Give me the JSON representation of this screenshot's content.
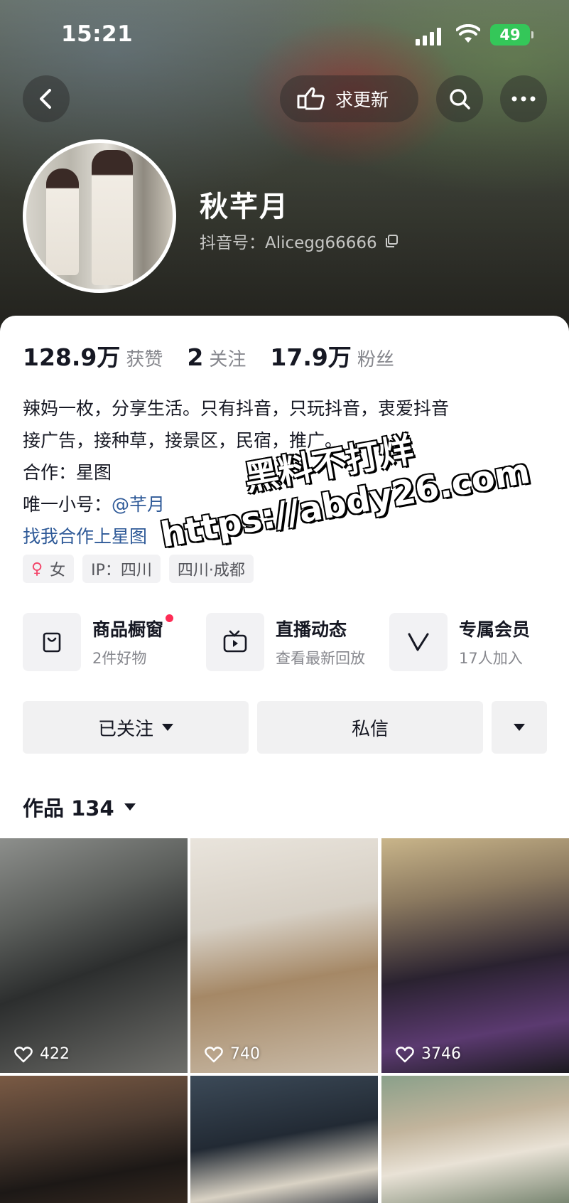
{
  "status_bar": {
    "time": "15:21",
    "battery": "49"
  },
  "header": {
    "request_update_label": "求更新",
    "icons": [
      "back-icon",
      "hand-point-icon",
      "search-icon",
      "more-icon"
    ]
  },
  "profile": {
    "nickname": "秋芊月",
    "douyin_id": "抖音号：Alicegg66666"
  },
  "stats": [
    {
      "value": "128.9万",
      "label": "获赞"
    },
    {
      "value": "2",
      "label": "关注"
    },
    {
      "value": "17.9万",
      "label": "粉丝"
    }
  ],
  "bio": {
    "line1": "辣妈一枚，分享生活。只有抖音，只玩抖音，衷爱抖音",
    "line2": "接广告，接种草，接景区，民宿，推广。",
    "line3": "合作：星图",
    "line4_prefix": "唯一小号：",
    "line4_mention": "@芊月",
    "link": "找我合作上星图"
  },
  "tags": {
    "gender": "女",
    "ip": "IP：四川",
    "location": "四川·成都"
  },
  "services": [
    {
      "title": "商品橱窗",
      "sub": "2件好物",
      "icon": "shopping-bag-icon",
      "has_dot": true
    },
    {
      "title": "直播动态",
      "sub": "查看最新回放",
      "icon": "tv-icon",
      "has_dot": false
    },
    {
      "title": "专属会员",
      "sub": "17人加入",
      "icon": "v-icon",
      "has_dot": false
    }
  ],
  "actions": {
    "follow_label": "已关注",
    "message_label": "私信"
  },
  "works": {
    "label": "作品 134"
  },
  "videos": [
    {
      "likes": "422"
    },
    {
      "likes": "740"
    },
    {
      "likes": "3746"
    },
    {
      "likes": ""
    },
    {
      "likes": ""
    },
    {
      "likes": ""
    }
  ],
  "watermark": {
    "line1": "黑料不打烊",
    "line2": "https://abdy26.com"
  },
  "colors": {
    "accent_red": "#fe2c55",
    "link_blue": "#2f5a98",
    "battery_green": "#34c759"
  }
}
